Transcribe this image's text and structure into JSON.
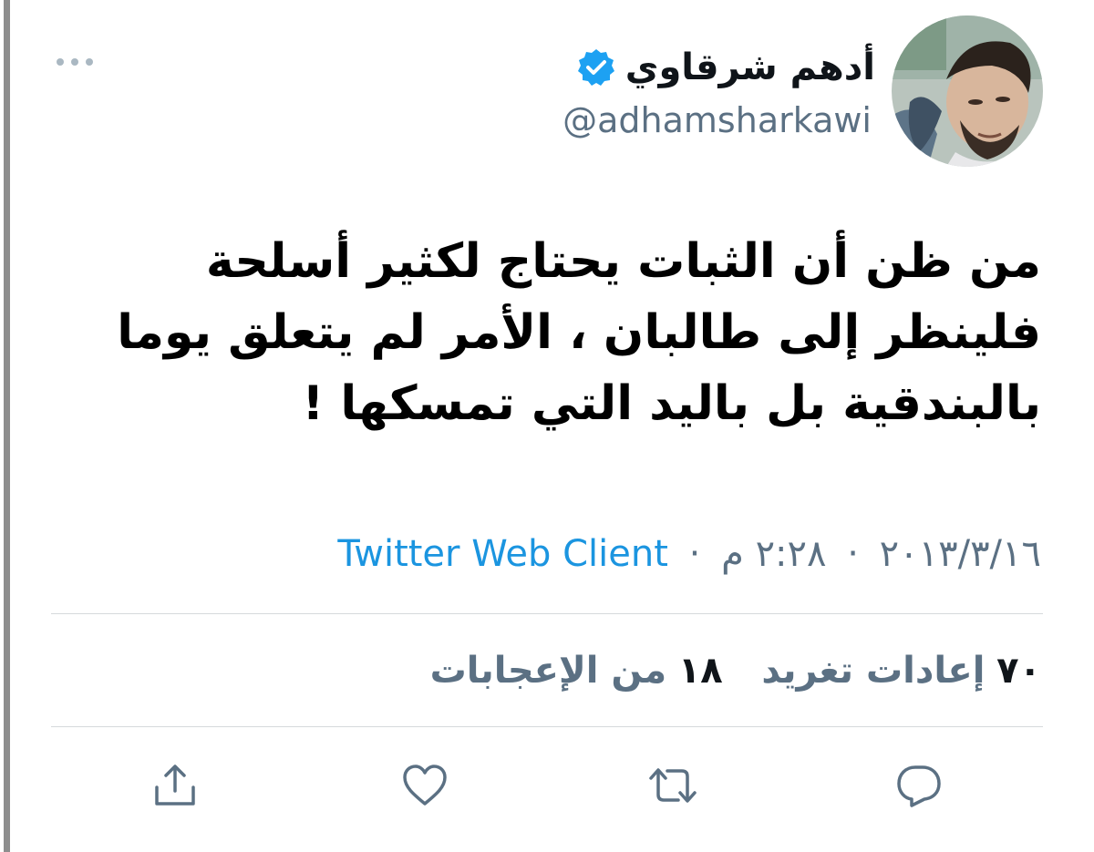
{
  "author": {
    "display_name": "أدهم شرقاوي",
    "handle": "@adhamsharkawi",
    "verified_icon": "verified-badge-icon"
  },
  "tweet": {
    "lines": [
      "من ظن أن الثبات يحتاج  لكثير أسلحة",
      "فلينظر إلى طالبان ، الأمر لم يتعلق يوما",
      "بالبندقية بل باليد التي تمسكها !"
    ]
  },
  "meta": {
    "date": "٢٠١٣/٣/١٦",
    "separator": "·",
    "time": "٢:٢٨ م",
    "client": "Twitter Web Client"
  },
  "stats": {
    "retweets_count": "٧٠",
    "retweets_label": "إعادات تغريد",
    "likes_count": "١٨",
    "likes_label": "من الإعجابات"
  },
  "actions": {
    "icons": [
      "reply-icon",
      "retweet-icon",
      "like-icon",
      "share-icon"
    ]
  },
  "colors": {
    "accent": "#1b95e0",
    "secondary_text": "#5b7083",
    "primary_text": "#0f1419",
    "verified": "#1da1f2",
    "divider": "#d6d9dc"
  }
}
